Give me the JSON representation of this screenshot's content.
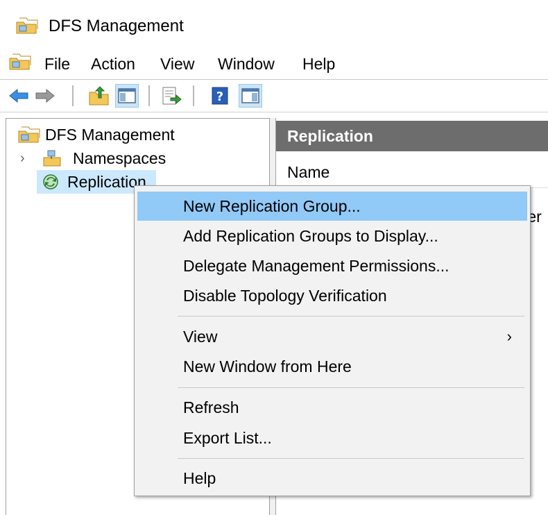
{
  "window": {
    "title": "DFS Management"
  },
  "menubar": {
    "items": [
      "File",
      "Action",
      "View",
      "Window",
      "Help"
    ]
  },
  "toolbar": {
    "buttons": [
      "back-arrow-icon",
      "forward-arrow-icon",
      "up-folder-icon",
      "show-hide-console-tree-icon",
      "export-list-icon",
      "help-icon",
      "show-hide-action-pane-icon"
    ]
  },
  "tree": {
    "root": "DFS Management",
    "items": [
      {
        "label": "Namespaces",
        "expander": "›"
      },
      {
        "label": "Replication"
      }
    ]
  },
  "right_pane": {
    "header": "Replication",
    "column_name": "Name",
    "clipped_text": "ter"
  },
  "context_menu": {
    "items": [
      {
        "label": "New Replication Group..."
      },
      {
        "label": "Add Replication Groups to Display..."
      },
      {
        "label": "Delegate Management Permissions..."
      },
      {
        "label": "Disable Topology Verification"
      },
      {
        "label": "View",
        "submenu_arrow": "›"
      },
      {
        "label": "New Window from Here"
      },
      {
        "label": "Refresh"
      },
      {
        "label": "Export List..."
      },
      {
        "label": "Help"
      }
    ],
    "highlighted_index": 0
  },
  "colors": {
    "highlight": "#91c9f7",
    "selection": "#cce8ff",
    "header_bg": "#6d6d6d"
  }
}
